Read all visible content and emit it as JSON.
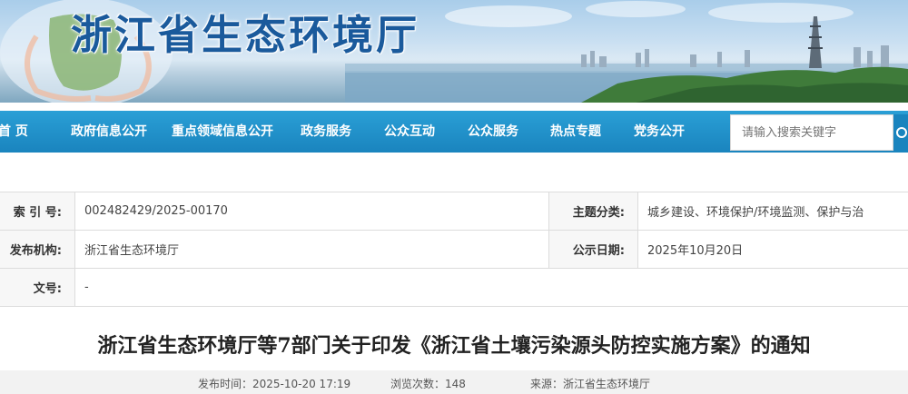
{
  "header": {
    "site_title": "浙江省生态环境厅"
  },
  "nav": {
    "items": [
      {
        "label": "首 页"
      },
      {
        "label": "政府信息公开"
      },
      {
        "label": "重点领域信息公开"
      },
      {
        "label": "政务服务"
      },
      {
        "label": "公众互动"
      },
      {
        "label": "公众服务"
      },
      {
        "label": "热点专题"
      },
      {
        "label": "党务公开"
      }
    ],
    "search_placeholder": "请输入搜索关键字"
  },
  "meta": {
    "index_label": "索 引 号:",
    "index_value": "002482429/2025-00170",
    "topic_label": "主题分类:",
    "topic_value": "城乡建设、环境保护/环境监测、保护与治",
    "issuer_label": "发布机构:",
    "issuer_value": "浙江省生态环境厅",
    "date_label": "公示日期:",
    "date_value": "2025年10月20日",
    "doc_label": "文号:",
    "doc_value": "-"
  },
  "article": {
    "title": "浙江省生态环境厅等7部门关于印发《浙江省土壤污染源头防控实施方案》的通知",
    "publish_time": "发布时间：2025-10-20 17:19",
    "views": "浏览次数：148",
    "source": "来源：浙江省生态环境厅"
  },
  "colors": {
    "nav_bg": "#1a84be",
    "title_blue": "#1a5a9c"
  }
}
